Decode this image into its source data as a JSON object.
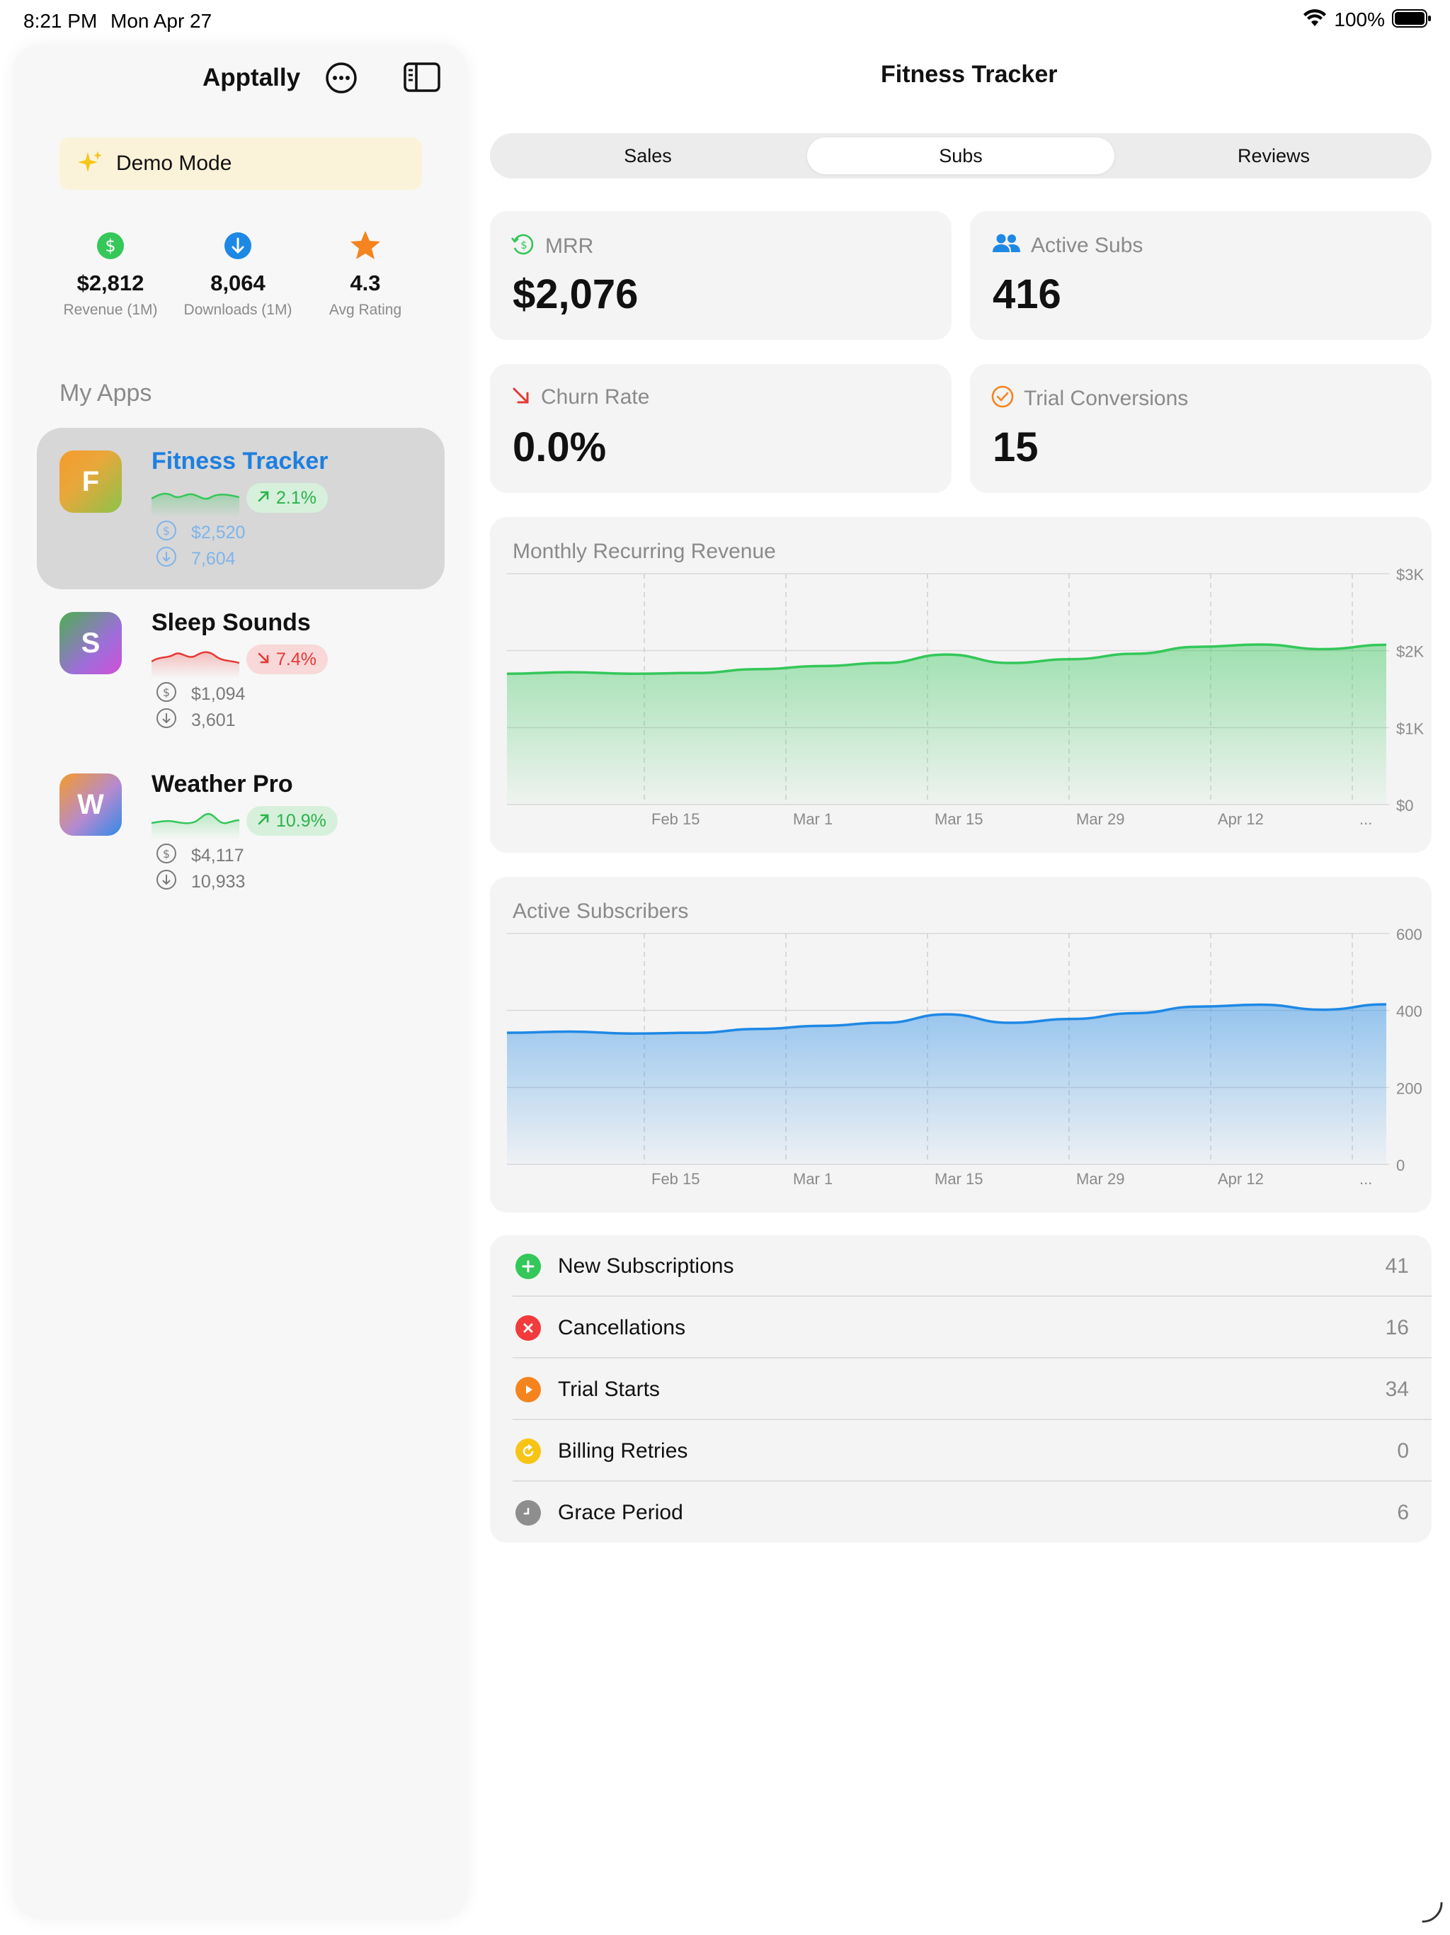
{
  "status_bar": {
    "time": "8:21 PM",
    "date": "Mon Apr 27",
    "battery": "100%"
  },
  "sidebar": {
    "title": "Apptally",
    "demo_label": "Demo Mode",
    "summary": [
      {
        "value": "$2,812",
        "label": "Revenue (1M)",
        "icon": "dollar-icon",
        "color": "#34c759"
      },
      {
        "value": "8,064",
        "label": "Downloads (1M)",
        "icon": "download-icon",
        "color": "#1e88e5"
      },
      {
        "value": "4.3",
        "label": "Avg Rating",
        "icon": "star-icon",
        "color": "#f5841f"
      }
    ],
    "my_apps_heading": "My Apps",
    "apps": [
      {
        "initial": "F",
        "name": "Fitness Tracker",
        "trend": "2.1%",
        "direction": "up",
        "revenue": "$2,520",
        "downloads": "7,604",
        "selected": true
      },
      {
        "initial": "S",
        "name": "Sleep Sounds",
        "trend": "7.4%",
        "direction": "down",
        "revenue": "$1,094",
        "downloads": "3,601",
        "selected": false
      },
      {
        "initial": "W",
        "name": "Weather Pro",
        "trend": "10.9%",
        "direction": "up",
        "revenue": "$4,117",
        "downloads": "10,933",
        "selected": false
      }
    ]
  },
  "main": {
    "title": "Fitness Tracker",
    "tabs": [
      {
        "label": "Sales",
        "active": false
      },
      {
        "label": "Subs",
        "active": true
      },
      {
        "label": "Reviews",
        "active": false
      }
    ],
    "metrics": [
      {
        "label": "MRR",
        "value": "$2,076",
        "icon": "dollar-refresh-icon",
        "color": "#34c759"
      },
      {
        "label": "Active Subs",
        "value": "416",
        "icon": "people-icon",
        "color": "#1e88e5"
      },
      {
        "label": "Churn Rate",
        "value": "0.0%",
        "icon": "arrow-down-right-icon",
        "color": "#e53935"
      },
      {
        "label": "Trial Conversions",
        "value": "15",
        "icon": "check-circle-icon",
        "color": "#f5841f"
      }
    ],
    "list": [
      {
        "label": "New Subscriptions",
        "value": "41",
        "icon": "plus-circle-icon",
        "color": "#34c759"
      },
      {
        "label": "Cancellations",
        "value": "16",
        "icon": "x-circle-icon",
        "color": "#f23b3b"
      },
      {
        "label": "Trial Starts",
        "value": "34",
        "icon": "play-circle-icon",
        "color": "#f5841f"
      },
      {
        "label": "Billing Retries",
        "value": "0",
        "icon": "retry-circle-icon",
        "color": "#f7c516"
      },
      {
        "label": "Grace Period",
        "value": "6",
        "icon": "clock-circle-icon",
        "color": "#8e8e8e"
      }
    ]
  },
  "chart_data": [
    {
      "type": "area",
      "title": "Monthly Recurring Revenue",
      "x_ticks": [
        "Feb 15",
        "Mar 1",
        "Mar 15",
        "Mar 29",
        "Apr 12",
        "..."
      ],
      "y_ticks": [
        "$0",
        "$1K",
        "$2K",
        "$3K"
      ],
      "ylim": [
        0,
        3000
      ],
      "color": "#34c759",
      "series": [
        {
          "values": [
            1700,
            1720,
            1700,
            1710,
            1760,
            1800,
            1840,
            1950,
            1840,
            1890,
            1960,
            2050,
            2080,
            2020,
            2076
          ]
        }
      ]
    },
    {
      "type": "area",
      "title": "Active Subscribers",
      "x_ticks": [
        "Feb 15",
        "Mar 1",
        "Mar 15",
        "Mar 29",
        "Apr 12",
        "..."
      ],
      "y_ticks": [
        "0",
        "200",
        "400",
        "600"
      ],
      "ylim": [
        0,
        600
      ],
      "color": "#1e88e5",
      "series": [
        {
          "values": [
            342,
            345,
            340,
            342,
            352,
            360,
            368,
            390,
            368,
            378,
            393,
            410,
            415,
            402,
            416
          ]
        }
      ]
    }
  ]
}
